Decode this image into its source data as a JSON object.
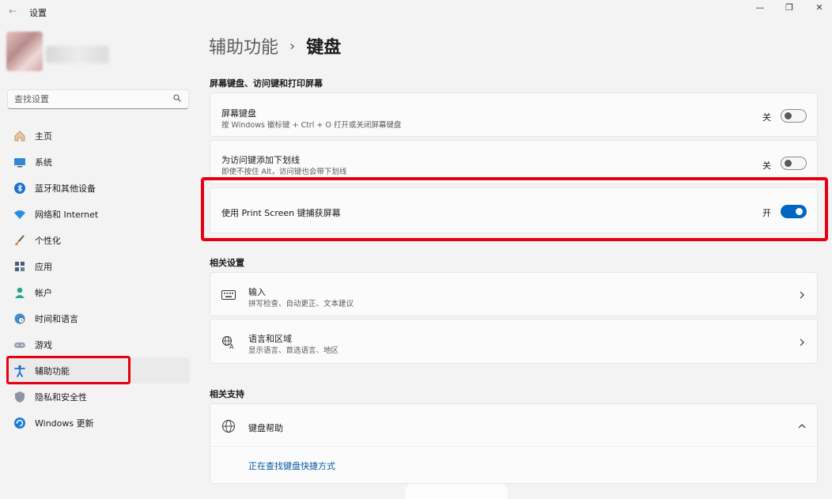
{
  "window": {
    "title": "设置",
    "back_icon": "back-arrow-icon",
    "controls": {
      "minimize": "—",
      "maximize": "❐",
      "close": "✕"
    }
  },
  "search": {
    "placeholder": "查找设置",
    "icon": "search-icon"
  },
  "nav": {
    "items": [
      {
        "label": "主页",
        "icon": "home-icon"
      },
      {
        "label": "系统",
        "icon": "monitor-icon"
      },
      {
        "label": "蓝牙和其他设备",
        "icon": "bluetooth-icon"
      },
      {
        "label": "网络和 Internet",
        "icon": "wifi-icon"
      },
      {
        "label": "个性化",
        "icon": "brush-icon"
      },
      {
        "label": "应用",
        "icon": "apps-icon"
      },
      {
        "label": "帐户",
        "icon": "person-icon"
      },
      {
        "label": "时间和语言",
        "icon": "globe-clock-icon"
      },
      {
        "label": "游戏",
        "icon": "gamepad-icon"
      },
      {
        "label": "辅助功能",
        "icon": "accessibility-icon",
        "active": true
      },
      {
        "label": "隐私和安全性",
        "icon": "shield-icon"
      },
      {
        "label": "Windows 更新",
        "icon": "update-icon"
      }
    ]
  },
  "breadcrumb": {
    "parent": "辅助功能",
    "separator": "›",
    "current": "键盘"
  },
  "sections": {
    "screen_keyboard": {
      "title": "屏幕键盘、访问键和打印屏幕",
      "items": [
        {
          "title": "屏幕键盘",
          "desc": "按 Windows 徽标键 + Ctrl + O 打开或关闭屏幕键盘",
          "state_label": "关",
          "on": false
        },
        {
          "title": "为访问键添加下划线",
          "desc": "即使不按住 Alt，访问键也会带下划线",
          "state_label": "关",
          "on": false
        },
        {
          "title": "使用 Print Screen 键捕获屏幕",
          "state_label": "开",
          "on": true
        }
      ]
    },
    "related_settings": {
      "title": "相关设置",
      "items": [
        {
          "title": "输入",
          "desc": "拼写检查、自动更正、文本建议",
          "icon": "keyboard-icon"
        },
        {
          "title": "语言和区域",
          "desc": "显示语言、首选语言、地区",
          "icon": "language-icon"
        }
      ]
    },
    "related_support": {
      "title": "相关支持",
      "help": {
        "title": "键盘帮助",
        "icon": "globe-icon",
        "link": "正在查找键盘快捷方式"
      }
    }
  },
  "colors": {
    "accent": "#0067c0",
    "highlight": "#e60012",
    "background": "#f3f3f3",
    "card": "#fbfbfb"
  }
}
